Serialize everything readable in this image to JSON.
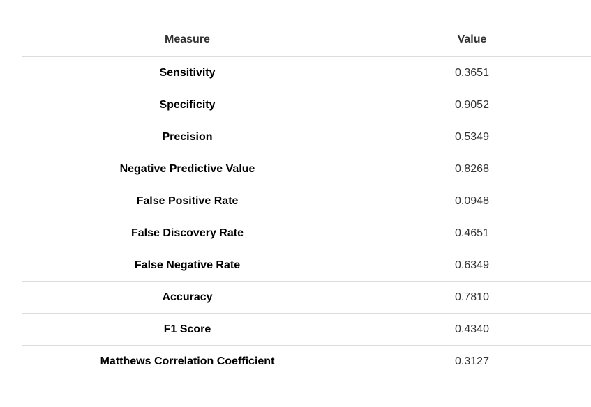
{
  "table": {
    "headers": {
      "measure": "Measure",
      "value": "Value"
    },
    "rows": [
      {
        "measure": "Sensitivity",
        "value": "0.3651"
      },
      {
        "measure": "Specificity",
        "value": "0.9052"
      },
      {
        "measure": "Precision",
        "value": "0.5349"
      },
      {
        "measure": "Negative Predictive Value",
        "value": "0.8268"
      },
      {
        "measure": "False Positive Rate",
        "value": "0.0948"
      },
      {
        "measure": "False Discovery Rate",
        "value": "0.4651"
      },
      {
        "measure": "False Negative Rate",
        "value": "0.6349"
      },
      {
        "measure": "Accuracy",
        "value": "0.7810"
      },
      {
        "measure": "F1 Score",
        "value": "0.4340"
      },
      {
        "measure": "Matthews Correlation Coefficient",
        "value": "0.3127"
      }
    ]
  },
  "colors": {
    "header_text": "#333333",
    "measure_text": "#000000",
    "value_text": "#333333",
    "divider": "#dddddd",
    "background": "#ffffff"
  }
}
